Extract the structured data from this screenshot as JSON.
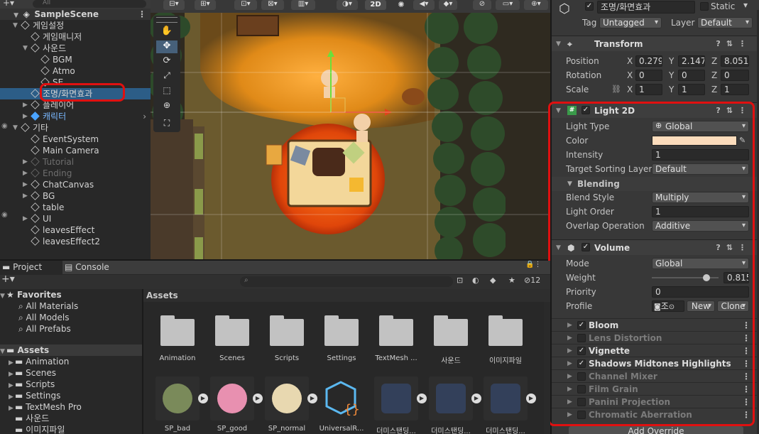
{
  "hierarchy": {
    "search_placeholder": "All",
    "scene_name": "SampleScene",
    "items": [
      {
        "label": "게임설정",
        "indent": 1,
        "state": "open",
        "dim": false
      },
      {
        "label": "게임매니저",
        "indent": 2,
        "state": "none",
        "dim": false
      },
      {
        "label": "사운드",
        "indent": 2,
        "state": "open",
        "dim": false
      },
      {
        "label": "BGM",
        "indent": 3,
        "state": "none",
        "dim": false
      },
      {
        "label": "Atmo",
        "indent": 3,
        "state": "none",
        "dim": false
      },
      {
        "label": "SE",
        "indent": 3,
        "state": "none",
        "dim": false
      },
      {
        "label": "조명/화면효과",
        "indent": 2,
        "state": "none",
        "dim": false,
        "selected": true
      },
      {
        "label": "플레이어",
        "indent": 2,
        "state": "closed",
        "dim": false
      },
      {
        "label": "캐릭터",
        "indent": 2,
        "state": "closed",
        "dim": false,
        "blue": true
      },
      {
        "label": "기타",
        "indent": 1,
        "state": "open",
        "dim": false
      },
      {
        "label": "EventSystem",
        "indent": 2,
        "state": "none",
        "dim": false
      },
      {
        "label": "Main Camera",
        "indent": 2,
        "state": "none",
        "dim": false
      },
      {
        "label": "Tutorial",
        "indent": 2,
        "state": "closed",
        "dim": true
      },
      {
        "label": "Ending",
        "indent": 2,
        "state": "closed",
        "dim": true
      },
      {
        "label": "ChatCanvas",
        "indent": 2,
        "state": "closed",
        "dim": false
      },
      {
        "label": "BG",
        "indent": 2,
        "state": "closed",
        "dim": false
      },
      {
        "label": "table",
        "indent": 2,
        "state": "none",
        "dim": false
      },
      {
        "label": "UI",
        "indent": 2,
        "state": "closed",
        "dim": false
      },
      {
        "label": "leavesEffect",
        "indent": 2,
        "state": "none",
        "dim": false
      },
      {
        "label": "leavesEffect2",
        "indent": 2,
        "state": "none",
        "dim": false
      }
    ]
  },
  "scene_toolbar": {
    "mode_2d": "2D"
  },
  "inspector": {
    "object_name": "조명/화면효과",
    "static_label": "Static",
    "tag_label": "Tag",
    "tag_value": "Untagged",
    "layer_label": "Layer",
    "layer_value": "Default",
    "transform": {
      "title": "Transform",
      "position_label": "Position",
      "rotation_label": "Rotation",
      "scale_label": "Scale",
      "x": "X",
      "y": "Y",
      "z": "Z",
      "position": [
        "0.2793",
        "2.1477",
        "8.0513"
      ],
      "rotation": [
        "0",
        "0",
        "0"
      ],
      "scale": [
        "1",
        "1",
        "1"
      ]
    },
    "light2d": {
      "title": "Light 2D",
      "light_type_label": "Light Type",
      "light_type_value": "Global",
      "color_label": "Color",
      "color_value": "#fcdcbc",
      "intensity_label": "Intensity",
      "intensity_value": "1",
      "sorting_label": "Target Sorting Layers",
      "sorting_value": "Default",
      "blending_label": "Blending",
      "blend_style_label": "Blend Style",
      "blend_style_value": "Multiply",
      "light_order_label": "Light Order",
      "light_order_value": "1",
      "overlap_label": "Overlap Operation",
      "overlap_value": "Additive"
    },
    "volume": {
      "title": "Volume",
      "mode_label": "Mode",
      "mode_value": "Global",
      "weight_label": "Weight",
      "weight_value": "0.815",
      "weight_fraction": 0.815,
      "priority_label": "Priority",
      "priority_value": "0",
      "profile_label": "Profile",
      "profile_value": "조",
      "new_button": "New",
      "clone_button": "Clone"
    },
    "overrides": [
      {
        "name": "Bloom",
        "enabled": true,
        "checked": true
      },
      {
        "name": "Lens Distortion",
        "enabled": false,
        "checked": false
      },
      {
        "name": "Vignette",
        "enabled": true,
        "checked": true
      },
      {
        "name": "Shadows Midtones Highlights",
        "enabled": true,
        "checked": true
      },
      {
        "name": "Channel Mixer",
        "enabled": false,
        "checked": false
      },
      {
        "name": "Film Grain",
        "enabled": false,
        "checked": false
      },
      {
        "name": "Panini Projection",
        "enabled": false,
        "checked": false
      },
      {
        "name": "Chromatic Aberration",
        "enabled": false,
        "checked": false
      }
    ],
    "add_override_button": "Add Override"
  },
  "project": {
    "tab_project": "Project",
    "tab_console": "Console",
    "hidden_count": "12",
    "favorites_label": "Favorites",
    "favorites": [
      "All Materials",
      "All Models",
      "All Prefabs"
    ],
    "assets_label": "Assets",
    "asset_folders": [
      "Animation",
      "Scenes",
      "Scripts",
      "Settings",
      "TextMesh Pro",
      "사운드",
      "이미지파일"
    ],
    "grid_header": "Assets",
    "grid_folders": [
      "Animation",
      "Scenes",
      "Scripts",
      "Settings",
      "TextMesh ...",
      "사운드",
      "이미지파일"
    ],
    "grid_items": [
      "SP_bad",
      "SP_good",
      "SP_normal",
      "UniversalR...",
      "더미스탠딩...",
      "더미스탠딩...",
      "더미스탠딩..."
    ]
  },
  "colors": {
    "selection": "#2c5d87",
    "highlight_red": "#e01010",
    "accent_blue": "#4aa3ff"
  }
}
